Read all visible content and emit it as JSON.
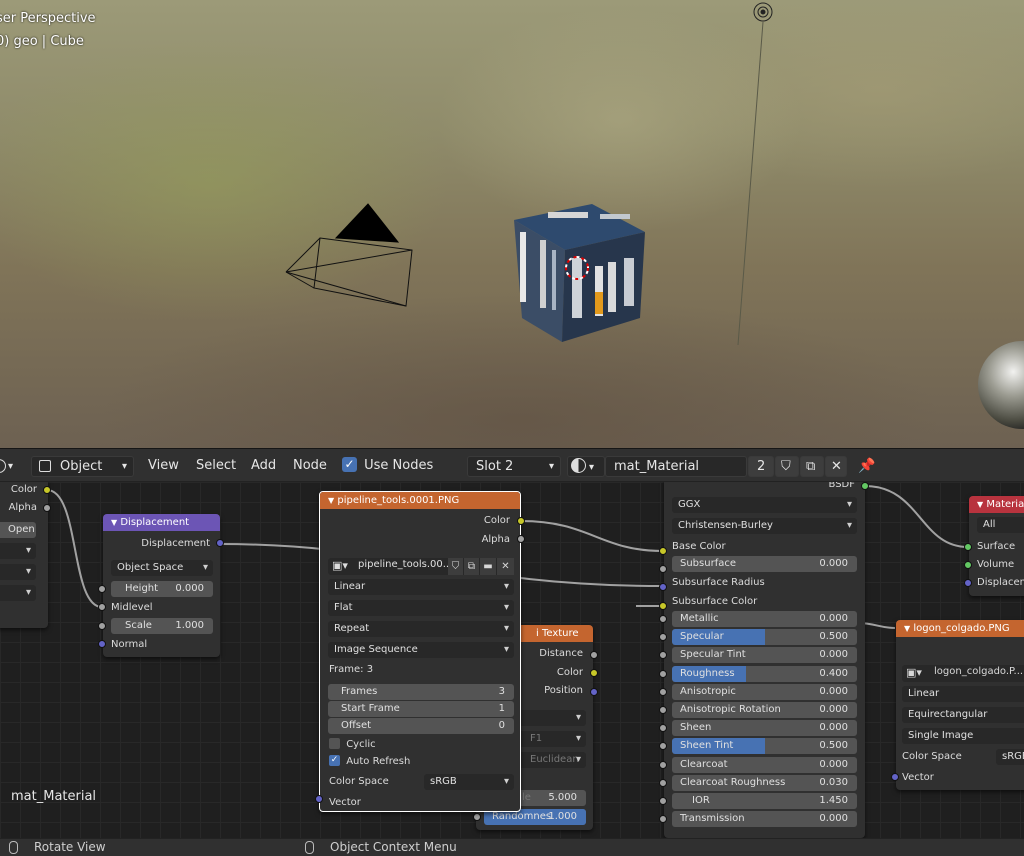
{
  "viewport": {
    "perspective_label": "ser Perspective",
    "object_label": "0) geo | Cube"
  },
  "header": {
    "mode": "Object",
    "menus": [
      "View",
      "Select",
      "Add",
      "Node"
    ],
    "use_nodes_label": "Use Nodes",
    "use_nodes_checked": true,
    "slot": "Slot 2",
    "material_name": "mat_Material",
    "user_count": "2"
  },
  "editor": {
    "material_label": "mat_Material"
  },
  "left_node": {
    "outputs": [
      "Color",
      "Alpha"
    ],
    "open_label": "Open"
  },
  "displacement": {
    "title": "Displacement",
    "output": "Displacement",
    "space": "Object Space",
    "height_label": "Height",
    "height_value": "0.000",
    "midlevel": "Midlevel",
    "scale_label": "Scale",
    "scale_value": "1.000",
    "normal": "Normal"
  },
  "image_node": {
    "title": "pipeline_tools.0001.PNG",
    "outputs": [
      "Color",
      "Alpha"
    ],
    "image_name": "pipeline_tools.00...",
    "interpolation": "Linear",
    "projection": "Flat",
    "extension": "Repeat",
    "source": "Image Sequence",
    "frame_label": "Frame: 3",
    "frames_label": "Frames",
    "frames_value": "3",
    "start_label": "Start Frame",
    "start_value": "1",
    "offset_label": "Offset",
    "offset_value": "0",
    "cyclic": "Cyclic",
    "auto_refresh": "Auto Refresh",
    "color_space_label": "Color Space",
    "color_space": "sRGB",
    "vector": "Vector"
  },
  "voronoi": {
    "title_visible": "i Texture",
    "outputs": [
      "Distance",
      "Color",
      "Position"
    ],
    "partial_f1": "F1",
    "partial_euclid": "Euclidean",
    "scale_label": "Scale",
    "scale_value": "5.000",
    "random_label": "Randomnes",
    "random_value": "1.000"
  },
  "bsdf": {
    "output": "BSDF",
    "distribution": "GGX",
    "subsurface_method": "Christensen-Burley",
    "base_color": "Base Color",
    "subsurface": {
      "label": "Subsurface",
      "value": "0.000"
    },
    "subsurface_radius": "Subsurface Radius",
    "subsurface_color": "Subsurface Color",
    "params": [
      {
        "label": "Metallic",
        "value": "0.000",
        "fill": 0
      },
      {
        "label": "Specular",
        "value": "0.500",
        "fill": 0.5
      },
      {
        "label": "Specular Tint",
        "value": "0.000",
        "fill": 0
      },
      {
        "label": "Roughness",
        "value": "0.400",
        "fill": 0.4
      },
      {
        "label": "Anisotropic",
        "value": "0.000",
        "fill": 0
      },
      {
        "label": "Anisotropic Rotation",
        "value": "0.000",
        "fill": 0
      },
      {
        "label": "Sheen",
        "value": "0.000",
        "fill": 0
      },
      {
        "label": "Sheen Tint",
        "value": "0.500",
        "fill": 0.5
      },
      {
        "label": "Clearcoat",
        "value": "0.000",
        "fill": 0
      },
      {
        "label": "Clearcoat Roughness",
        "value": "0.030",
        "fill": 0.03
      },
      {
        "label": "IOR",
        "value": "1.450",
        "fill": 0
      },
      {
        "label": "Transmission",
        "value": "0.000",
        "fill": 0
      }
    ]
  },
  "output_node": {
    "title": "Material",
    "target": "All",
    "inputs": [
      "Surface",
      "Volume",
      "Displacem"
    ]
  },
  "logon_node": {
    "title": "logon_colgado.PNG",
    "image_name": "logon_colgado.P...",
    "interpolation": "Linear",
    "projection": "Equirectangular",
    "source": "Single Image",
    "color_space_label": "Color Space",
    "color_space": "sRGB",
    "vector": "Vector"
  },
  "status": {
    "left": "Rotate View",
    "middle": "Object Context Menu"
  },
  "colors": {
    "header_bg": "#303030",
    "node_bg": "#303030",
    "texture_header": "#c4652f",
    "vector_header": "#6c55b5",
    "output_header": "#b8333e",
    "accent": "#4772b3"
  }
}
